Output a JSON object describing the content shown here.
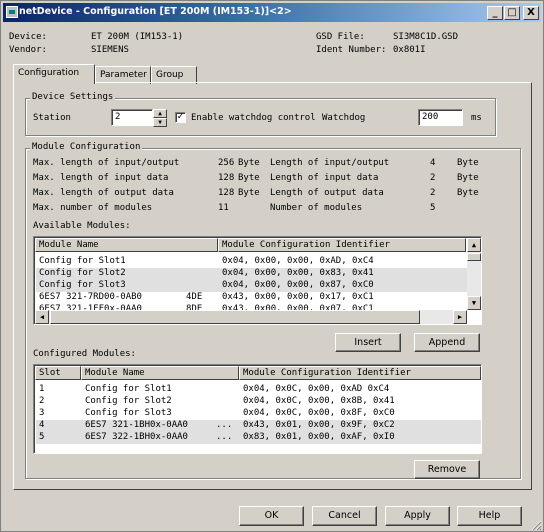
{
  "window": {
    "title": "netDevice - Configuration [ET 200M (IM153-1)]<2>",
    "minimize": "_",
    "maximize": "□",
    "close": "X"
  },
  "device_info": {
    "device_label": "Device:",
    "device_value": "ET 200M (IM153-1)",
    "vendor_label": "Vendor:",
    "vendor_value": "SIEMENS",
    "gsd_label": "GSD File:",
    "gsd_value": "SI3M8C1D.GSD",
    "ident_label": "Ident Number:",
    "ident_value": "0x801I"
  },
  "tabs": [
    "Configuration",
    "Parameter",
    "Group"
  ],
  "device_settings": {
    "title": "Device Settings",
    "station_label": "Station",
    "station_value": "2",
    "watchdog_check_label": "Enable watchdog control",
    "watchdog_checked": "✓",
    "watchdog_label": "Watchdog",
    "watchdog_value": "200",
    "watchdog_unit": "ms"
  },
  "module_config": {
    "title": "Module Configuration",
    "rows": [
      {
        "label": "Max. length of input/output",
        "value": "256",
        "unit": "Byte",
        "label2": "Length of input/output",
        "value2": "4",
        "unit2": "Byte"
      },
      {
        "label": "Max. length of input data",
        "value": "128",
        "unit": "Byte",
        "label2": "Length of input data",
        "value2": "2",
        "unit2": "Byte"
      },
      {
        "label": "Max. length of output data",
        "value": "128",
        "unit": "Byte",
        "label2": "Length of output data",
        "value2": "2",
        "unit2": "Byte"
      },
      {
        "label": "Max. number of modules",
        "value": "11",
        "unit": "",
        "label2": "Number of modules",
        "value2": "5",
        "unit2": ""
      }
    ]
  },
  "available": {
    "title": "Available Modules:",
    "headers": [
      "Module Name",
      "Module Configuration Identifier"
    ],
    "rows": [
      {
        "name": "Config for Slot1",
        "extra": "",
        "id": "0x04, 0x00, 0x00, 0xAD, 0xC4"
      },
      {
        "name": "Config for Slot2",
        "extra": "",
        "id": "0x04, 0x00, 0x00, 0x83, 0x41"
      },
      {
        "name": "Config for Slot3",
        "extra": "",
        "id": "0x04, 0x00, 0x00, 0x87, 0xC0"
      },
      {
        "name": "6ES7 321-7RD00-0AB0",
        "extra": "4DE",
        "id": "0x43, 0x00, 0x00, 0x17, 0xC1"
      },
      {
        "name": "6ES7 321-1FF0x-0AA0",
        "extra": "8DE",
        "id": "0x43, 0x00, 0x00, 0x07, 0xC1"
      }
    ]
  },
  "buttons": {
    "insert": "Insert",
    "append": "Append",
    "remove": "Remove",
    "ok": "OK",
    "cancel": "Cancel",
    "apply": "Apply",
    "help": "Help"
  },
  "configured": {
    "title": "Configured Modules:",
    "headers": [
      "Slot",
      "Module Name",
      "Module Configuration Identifier"
    ],
    "rows": [
      {
        "slot": "1",
        "name": "Config for Slot1",
        "extra": "",
        "id": "0x04, 0x0C, 0x00, 0xAD 0xC4"
      },
      {
        "slot": "2",
        "name": "Config for Slot2",
        "extra": "",
        "id": "0x04, 0x0C, 0x00, 0x8B, 0x41"
      },
      {
        "slot": "3",
        "name": "Config for Slot3",
        "extra": "",
        "id": "0x04, 0x0C, 0x00, 0x8F, 0xC0"
      },
      {
        "slot": "4",
        "name": "6ES7 321-1BH0x-0AA0",
        "extra": "...",
        "id": "0x43, 0x01, 0x00, 0x9F, 0xC2"
      },
      {
        "slot": "5",
        "name": "6ES7 322-1BH0x-0AA0",
        "extra": "...",
        "id": "0x83, 0x01, 0x00, 0xAF, 0xI0"
      }
    ]
  }
}
